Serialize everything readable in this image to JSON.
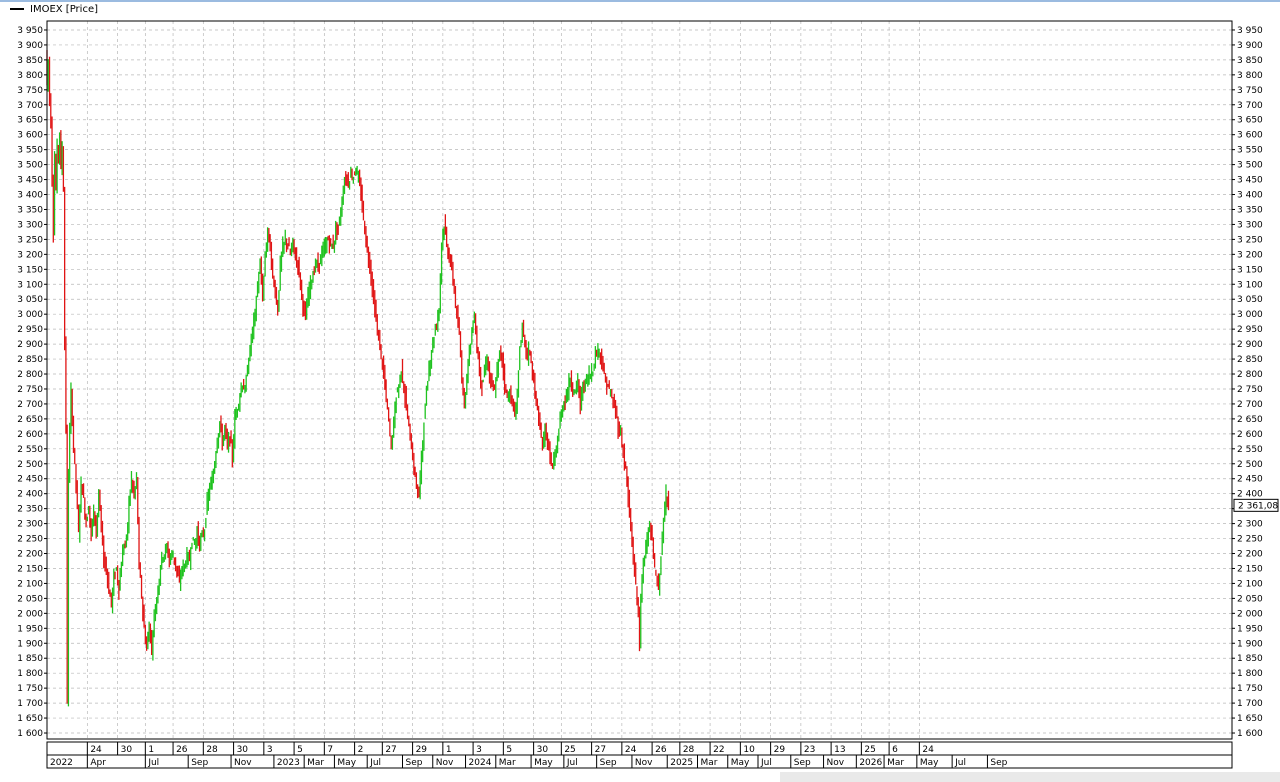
{
  "legend": {
    "label": "IMOEX [Price]",
    "swatch_color": "#000000"
  },
  "colors": {
    "up": "#1fc21f",
    "down": "#e01414",
    "grid": "#b8b8b8",
    "price_box": "#000000"
  },
  "chart_data": {
    "type": "candlestick",
    "series": [
      {
        "name": "IMOEX [Price]"
      }
    ],
    "ylim": [
      1580,
      3980
    ],
    "yticks": [
      1600,
      1650,
      1700,
      1750,
      1800,
      1850,
      1900,
      1950,
      2000,
      2050,
      2100,
      2150,
      2200,
      2250,
      2300,
      2350,
      2400,
      2450,
      2500,
      2550,
      2600,
      2650,
      2700,
      2750,
      2800,
      2850,
      2900,
      2950,
      3000,
      3050,
      3100,
      3150,
      3200,
      3250,
      3300,
      3350,
      3400,
      3450,
      3500,
      3550,
      3600,
      3650,
      3700,
      3750,
      3800,
      3850,
      3900,
      3950
    ],
    "ytick_labels": [
      "1 600",
      "1 650",
      "1 700",
      "1 750",
      "1 800",
      "1 850",
      "1 900",
      "1 950",
      "2 000",
      "2 050",
      "2 100",
      "2 150",
      "2 200",
      "2 250",
      "2 300",
      "2 350",
      "2 400",
      "2 450",
      "2 500",
      "2 550",
      "2 600",
      "2 650",
      "2 700",
      "2 750",
      "2 800",
      "2 850",
      "2 900",
      "2 950",
      "3 000",
      "3 050",
      "3 100",
      "3 150",
      "3 200",
      "3 250",
      "3 300",
      "3 350",
      "3 400",
      "3 450",
      "3 500",
      "3 550",
      "3 600",
      "3 650",
      "3 700",
      "3 750",
      "3 800",
      "3 850",
      "3 900",
      "3 950"
    ],
    "xlim": [
      2022.0,
      2026.7
    ],
    "day_ticks": [
      {
        "label": "24",
        "x": 2022.16
      },
      {
        "label": "30",
        "x": 2022.28
      },
      {
        "label": "1",
        "x": 2022.39
      },
      {
        "label": "26",
        "x": 2022.5
      },
      {
        "label": "28",
        "x": 2022.62
      },
      {
        "label": "30",
        "x": 2022.74
      },
      {
        "label": "3",
        "x": 2022.86
      },
      {
        "label": "5",
        "x": 2022.98
      },
      {
        "label": "7",
        "x": 2023.1
      },
      {
        "label": "2",
        "x": 2023.22
      },
      {
        "label": "27",
        "x": 2023.33
      },
      {
        "label": "29",
        "x": 2023.45
      },
      {
        "label": "1",
        "x": 2023.57
      },
      {
        "label": "3",
        "x": 2023.69
      },
      {
        "label": "5",
        "x": 2023.81
      },
      {
        "label": "30",
        "x": 2023.93
      },
      {
        "label": "25",
        "x": 2024.04
      },
      {
        "label": "27",
        "x": 2024.16
      },
      {
        "label": "24",
        "x": 2024.28
      },
      {
        "label": "26",
        "x": 2024.4
      },
      {
        "label": "28",
        "x": 2024.51
      },
      {
        "label": "22",
        "x": 2024.63
      },
      {
        "label": "10",
        "x": 2024.75
      },
      {
        "label": "29",
        "x": 2024.87
      },
      {
        "label": "23",
        "x": 2024.99
      },
      {
        "label": "13",
        "x": 2025.11
      },
      {
        "label": "25",
        "x": 2025.23
      },
      {
        "label": "6",
        "x": 2025.34
      },
      {
        "label": "24",
        "x": 2025.46
      }
    ],
    "month_ticks": [
      {
        "label": "2022",
        "x": 2022.0
      },
      {
        "label": "Apr",
        "x": 2022.16
      },
      {
        "label": "Jul",
        "x": 2022.39
      },
      {
        "label": "Sep",
        "x": 2022.56
      },
      {
        "label": "Nov",
        "x": 2022.73
      },
      {
        "label": "2023",
        "x": 2022.9
      },
      {
        "label": "Mar",
        "x": 2023.02
      },
      {
        "label": "May",
        "x": 2023.14
      },
      {
        "label": "Jul",
        "x": 2023.27
      },
      {
        "label": "Sep",
        "x": 2023.41
      },
      {
        "label": "Nov",
        "x": 2023.53
      },
      {
        "label": "2024",
        "x": 2023.66
      },
      {
        "label": "Mar",
        "x": 2023.78
      },
      {
        "label": "May",
        "x": 2023.92
      },
      {
        "label": "Jul",
        "x": 2024.05
      },
      {
        "label": "Sep",
        "x": 2024.18
      },
      {
        "label": "Nov",
        "x": 2024.32
      },
      {
        "label": "2025",
        "x": 2024.46
      },
      {
        "label": "Mar",
        "x": 2024.58
      },
      {
        "label": "May",
        "x": 2024.7
      },
      {
        "label": "Jul",
        "x": 2024.82
      },
      {
        "label": "Sep",
        "x": 2024.95
      },
      {
        "label": "Nov",
        "x": 2025.08
      },
      {
        "label": "2026",
        "x": 2025.21
      },
      {
        "label": "Mar",
        "x": 2025.32
      },
      {
        "label": "May",
        "x": 2025.45
      },
      {
        "label": "Jul",
        "x": 2025.59
      },
      {
        "label": "Sep",
        "x": 2025.73
      }
    ],
    "path": [
      [
        2022.0,
        3880
      ],
      [
        2022.005,
        3770
      ],
      [
        2022.01,
        3850
      ],
      [
        2022.015,
        3720
      ],
      [
        2022.02,
        3640
      ],
      [
        2022.025,
        3450
      ],
      [
        2022.03,
        3280
      ],
      [
        2022.035,
        3520
      ],
      [
        2022.04,
        3420
      ],
      [
        2022.045,
        3560
      ],
      [
        2022.05,
        3530
      ],
      [
        2022.055,
        3610
      ],
      [
        2022.06,
        3480
      ],
      [
        2022.065,
        3560
      ],
      [
        2022.07,
        3420
      ],
      [
        2022.075,
        2900
      ],
      [
        2022.08,
        2620
      ],
      [
        2022.085,
        1700
      ],
      [
        2022.09,
        2470
      ],
      [
        2022.1,
        2740
      ],
      [
        2022.11,
        2560
      ],
      [
        2022.12,
        2430
      ],
      [
        2022.13,
        2270
      ],
      [
        2022.14,
        2440
      ],
      [
        2022.15,
        2380
      ],
      [
        2022.16,
        2300
      ],
      [
        2022.17,
        2360
      ],
      [
        2022.18,
        2260
      ],
      [
        2022.19,
        2350
      ],
      [
        2022.2,
        2280
      ],
      [
        2022.21,
        2390
      ],
      [
        2022.22,
        2290
      ],
      [
        2022.23,
        2180
      ],
      [
        2022.24,
        2150
      ],
      [
        2022.25,
        2080
      ],
      [
        2022.26,
        2030
      ],
      [
        2022.27,
        2120
      ],
      [
        2022.28,
        2150
      ],
      [
        2022.29,
        2080
      ],
      [
        2022.3,
        2170
      ],
      [
        2022.31,
        2230
      ],
      [
        2022.32,
        2240
      ],
      [
        2022.33,
        2370
      ],
      [
        2022.34,
        2450
      ],
      [
        2022.35,
        2390
      ],
      [
        2022.36,
        2450
      ],
      [
        2022.37,
        2160
      ],
      [
        2022.38,
        2060
      ],
      [
        2022.39,
        1950
      ],
      [
        2022.4,
        1880
      ],
      [
        2022.41,
        1960
      ],
      [
        2022.42,
        1880
      ],
      [
        2022.43,
        1990
      ],
      [
        2022.44,
        2050
      ],
      [
        2022.45,
        2120
      ],
      [
        2022.46,
        2190
      ],
      [
        2022.47,
        2200
      ],
      [
        2022.48,
        2220
      ],
      [
        2022.49,
        2180
      ],
      [
        2022.5,
        2200
      ],
      [
        2022.51,
        2180
      ],
      [
        2022.52,
        2140
      ],
      [
        2022.53,
        2100
      ],
      [
        2022.54,
        2150
      ],
      [
        2022.55,
        2160
      ],
      [
        2022.56,
        2190
      ],
      [
        2022.57,
        2180
      ],
      [
        2022.58,
        2250
      ],
      [
        2022.59,
        2230
      ],
      [
        2022.6,
        2270
      ],
      [
        2022.61,
        2230
      ],
      [
        2022.62,
        2260
      ],
      [
        2022.63,
        2280
      ],
      [
        2022.64,
        2370
      ],
      [
        2022.65,
        2420
      ],
      [
        2022.66,
        2440
      ],
      [
        2022.67,
        2510
      ],
      [
        2022.68,
        2580
      ],
      [
        2022.69,
        2640
      ],
      [
        2022.7,
        2570
      ],
      [
        2022.71,
        2620
      ],
      [
        2022.72,
        2560
      ],
      [
        2022.73,
        2590
      ],
      [
        2022.74,
        2520
      ],
      [
        2022.75,
        2650
      ],
      [
        2022.76,
        2690
      ],
      [
        2022.77,
        2730
      ],
      [
        2022.78,
        2770
      ],
      [
        2022.79,
        2740
      ],
      [
        2022.8,
        2820
      ],
      [
        2022.81,
        2880
      ],
      [
        2022.82,
        2950
      ],
      [
        2022.83,
        3000
      ],
      [
        2022.84,
        3100
      ],
      [
        2022.85,
        3160
      ],
      [
        2022.86,
        3060
      ],
      [
        2022.87,
        3190
      ],
      [
        2022.88,
        3280
      ],
      [
        2022.89,
        3220
      ],
      [
        2022.9,
        3120
      ],
      [
        2022.91,
        3080
      ],
      [
        2022.92,
        3010
      ],
      [
        2022.93,
        3170
      ],
      [
        2022.94,
        3220
      ],
      [
        2022.95,
        3250
      ],
      [
        2022.96,
        3230
      ],
      [
        2022.97,
        3200
      ],
      [
        2022.98,
        3240
      ],
      [
        2022.99,
        3190
      ],
      [
        2023.0,
        3170
      ],
      [
        2023.01,
        3100
      ],
      [
        2023.02,
        3030
      ],
      [
        2023.03,
        2990
      ],
      [
        2023.04,
        3060
      ],
      [
        2023.05,
        3110
      ],
      [
        2023.06,
        3130
      ],
      [
        2023.07,
        3170
      ],
      [
        2023.08,
        3160
      ],
      [
        2023.09,
        3190
      ],
      [
        2023.1,
        3210
      ],
      [
        2023.11,
        3230
      ],
      [
        2023.12,
        3250
      ],
      [
        2023.13,
        3230
      ],
      [
        2023.14,
        3230
      ],
      [
        2023.15,
        3280
      ],
      [
        2023.16,
        3290
      ],
      [
        2023.17,
        3340
      ],
      [
        2023.18,
        3420
      ],
      [
        2023.19,
        3460
      ],
      [
        2023.2,
        3440
      ],
      [
        2023.21,
        3470
      ],
      [
        2023.22,
        3460
      ],
      [
        2023.23,
        3490
      ],
      [
        2023.24,
        3450
      ],
      [
        2023.25,
        3400
      ],
      [
        2023.26,
        3320
      ],
      [
        2023.27,
        3240
      ],
      [
        2023.28,
        3190
      ],
      [
        2023.29,
        3130
      ],
      [
        2023.3,
        3050
      ],
      [
        2023.31,
        2980
      ],
      [
        2023.32,
        2920
      ],
      [
        2023.33,
        2860
      ],
      [
        2023.34,
        2800
      ],
      [
        2023.35,
        2720
      ],
      [
        2023.36,
        2640
      ],
      [
        2023.37,
        2560
      ],
      [
        2023.38,
        2640
      ],
      [
        2023.39,
        2730
      ],
      [
        2023.4,
        2760
      ],
      [
        2023.41,
        2820
      ],
      [
        2023.42,
        2750
      ],
      [
        2023.43,
        2690
      ],
      [
        2023.44,
        2620
      ],
      [
        2023.45,
        2560
      ],
      [
        2023.46,
        2480
      ],
      [
        2023.47,
        2430
      ],
      [
        2023.48,
        2390
      ],
      [
        2023.49,
        2520
      ],
      [
        2023.5,
        2640
      ],
      [
        2023.51,
        2740
      ],
      [
        2023.52,
        2820
      ],
      [
        2023.53,
        2880
      ],
      [
        2023.54,
        2930
      ],
      [
        2023.55,
        2970
      ],
      [
        2023.56,
        3020
      ],
      [
        2023.57,
        3240
      ],
      [
        2023.58,
        3300
      ],
      [
        2023.59,
        3230
      ],
      [
        2023.6,
        3190
      ],
      [
        2023.61,
        3150
      ],
      [
        2023.62,
        3080
      ],
      [
        2023.63,
        2990
      ],
      [
        2023.64,
        2930
      ],
      [
        2023.65,
        2790
      ],
      [
        2023.66,
        2700
      ],
      [
        2023.67,
        2800
      ],
      [
        2023.68,
        2880
      ],
      [
        2023.69,
        2940
      ],
      [
        2023.7,
        3000
      ],
      [
        2023.71,
        2890
      ],
      [
        2023.72,
        2810
      ],
      [
        2023.73,
        2760
      ],
      [
        2023.74,
        2810
      ],
      [
        2023.75,
        2850
      ],
      [
        2023.76,
        2790
      ],
      [
        2023.77,
        2760
      ],
      [
        2023.78,
        2740
      ],
      [
        2023.79,
        2810
      ],
      [
        2023.8,
        2870
      ],
      [
        2023.81,
        2850
      ],
      [
        2023.82,
        2770
      ],
      [
        2023.83,
        2720
      ],
      [
        2023.84,
        2740
      ],
      [
        2023.85,
        2700
      ],
      [
        2023.86,
        2660
      ],
      [
        2023.87,
        2730
      ],
      [
        2023.88,
        2890
      ],
      [
        2023.89,
        2950
      ],
      [
        2023.9,
        2900
      ],
      [
        2023.91,
        2860
      ],
      [
        2023.92,
        2880
      ],
      [
        2023.93,
        2800
      ],
      [
        2023.94,
        2740
      ],
      [
        2023.95,
        2680
      ],
      [
        2023.96,
        2610
      ],
      [
        2023.97,
        2560
      ],
      [
        2023.98,
        2620
      ],
      [
        2023.99,
        2570
      ],
      [
        2024.0,
        2520
      ],
      [
        2024.01,
        2490
      ],
      [
        2024.02,
        2520
      ],
      [
        2024.03,
        2580
      ],
      [
        2024.04,
        2650
      ],
      [
        2024.05,
        2690
      ],
      [
        2024.06,
        2720
      ],
      [
        2024.07,
        2740
      ],
      [
        2024.08,
        2790
      ],
      [
        2024.09,
        2750
      ],
      [
        2024.1,
        2740
      ],
      [
        2024.11,
        2780
      ],
      [
        2024.12,
        2690
      ],
      [
        2024.13,
        2760
      ],
      [
        2024.14,
        2770
      ],
      [
        2024.15,
        2790
      ],
      [
        2024.16,
        2800
      ],
      [
        2024.17,
        2820
      ],
      [
        2024.18,
        2860
      ],
      [
        2024.19,
        2890
      ],
      [
        2024.2,
        2860
      ],
      [
        2024.21,
        2820
      ],
      [
        2024.22,
        2770
      ],
      [
        2024.23,
        2760
      ],
      [
        2024.24,
        2730
      ],
      [
        2024.25,
        2700
      ],
      [
        2024.26,
        2680
      ],
      [
        2024.27,
        2620
      ],
      [
        2024.28,
        2600
      ],
      [
        2024.29,
        2540
      ],
      [
        2024.3,
        2480
      ],
      [
        2024.31,
        2380
      ],
      [
        2024.32,
        2280
      ],
      [
        2024.33,
        2190
      ],
      [
        2024.34,
        2090
      ],
      [
        2024.35,
        2000
      ],
      [
        2024.355,
        1900
      ],
      [
        2024.36,
        2050
      ],
      [
        2024.37,
        2160
      ],
      [
        2024.38,
        2240
      ],
      [
        2024.39,
        2280
      ],
      [
        2024.4,
        2270
      ],
      [
        2024.41,
        2190
      ],
      [
        2024.42,
        2120
      ],
      [
        2024.43,
        2080
      ],
      [
        2024.44,
        2200
      ],
      [
        2024.45,
        2300
      ],
      [
        2024.46,
        2400
      ],
      [
        2024.47,
        2380
      ]
    ],
    "last_price": 2361.08,
    "last_price_label": "2 361,08"
  }
}
